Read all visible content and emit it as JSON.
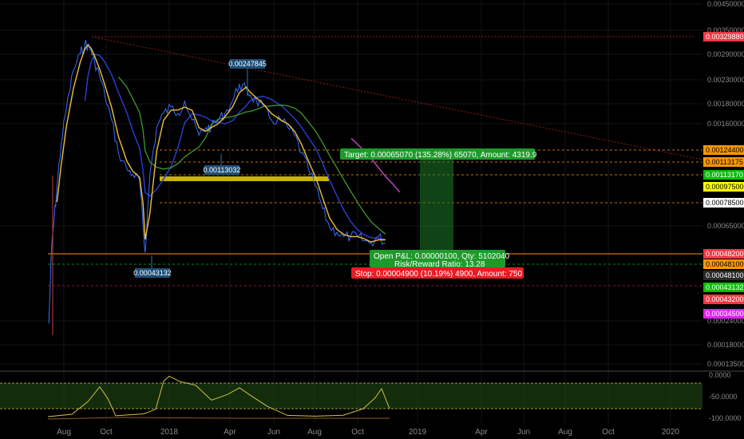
{
  "chart_data": {
    "type": "line",
    "log_scale": true,
    "grid": true,
    "price_axis_labels": [
      "0.00450000",
      "0.00350000",
      "0.00290000",
      "0.00230000",
      "0.00180000",
      "0.00160000",
      "0.00065000",
      "0.00024000",
      "0.00018000",
      "0.00013500"
    ],
    "time_axis_labels": [
      "Aug",
      "Oct",
      "2018",
      "Apr",
      "Jun",
      "Aug",
      "Oct",
      "2019",
      "Apr",
      "Jun",
      "Aug",
      "Oct",
      "2020"
    ],
    "price_series": {
      "x": [
        "2017-07-10",
        "2017-07-14",
        "2017-07-18",
        "2017-07-22",
        "2017-07-28",
        "2017-08-05",
        "2017-08-15",
        "2017-08-25",
        "2017-09-01",
        "2017-09-05",
        "2017-09-10",
        "2017-09-15",
        "2017-09-22",
        "2017-09-30",
        "2017-10-10",
        "2017-10-20",
        "2017-11-01",
        "2017-11-10",
        "2017-11-20",
        "2017-11-25",
        "2017-11-28",
        "2017-12-05",
        "2017-12-15",
        "2017-12-25",
        "2018-01-05",
        "2018-01-15",
        "2018-01-25",
        "2018-02-05",
        "2018-02-15",
        "2018-02-25",
        "2018-03-05",
        "2018-03-15",
        "2018-03-25",
        "2018-04-05",
        "2018-04-15",
        "2018-04-25",
        "2018-05-01",
        "2018-05-10",
        "2018-05-20",
        "2018-06-01",
        "2018-06-15",
        "2018-06-25",
        "2018-07-05",
        "2018-07-15",
        "2018-07-25",
        "2018-08-05",
        "2018-08-15",
        "2018-08-25",
        "2018-09-05",
        "2018-09-15",
        "2018-09-25",
        "2018-10-05",
        "2018-10-15",
        "2018-10-25",
        "2018-11-05",
        "2018-11-15"
      ],
      "y": [
        0.00022,
        0.00045,
        0.0006,
        0.0008,
        0.0012,
        0.0017,
        0.0024,
        0.0028,
        0.0031,
        0.003,
        0.0029,
        0.0026,
        0.0023,
        0.0019,
        0.0015,
        0.0011,
        0.00095,
        0.0009,
        0.00085,
        0.00055,
        0.00043,
        0.0009,
        0.0014,
        0.0016,
        0.0017,
        0.0016,
        0.0018,
        0.0015,
        0.0013,
        0.0014,
        0.0014,
        0.0015,
        0.0016,
        0.0018,
        0.0021,
        0.002,
        0.0019,
        0.0018,
        0.0017,
        0.0015,
        0.0015,
        0.0014,
        0.0013,
        0.0011,
        0.00095,
        0.0008,
        0.00065,
        0.00055,
        0.00052,
        0.0005,
        0.0005,
        0.0005,
        0.00048,
        0.00047,
        0.0005,
        0.00047
      ]
    },
    "annotations": [
      "0.00247845",
      "0.00113032",
      "0.00043132"
    ],
    "position": {
      "target_text": "Target: 0.00065070 (135.28%) 65070, Amount: 4319.9",
      "open_text": "Open P&L: 0.00000100, Qty: 5102040",
      "rr_text": "Risk/Reward Ratio: 13.28",
      "stop_text": "Stop: 0.00004900 (10.19%) 4900, Amount: 750"
    },
    "price_tags": [
      {
        "text": "0.00329880",
        "bg": "#f23645",
        "fg": "#ffffff"
      },
      {
        "text": "0.00124400",
        "bg": "#ff9800",
        "fg": "#000000"
      },
      {
        "text": "0.00113175",
        "bg": "#ff9800",
        "fg": "#000000"
      },
      {
        "text": "0.00113170",
        "bg": "#00c000",
        "fg": "#ffffff"
      },
      {
        "text": "0.00097500",
        "bg": "#ffff00",
        "fg": "#000000"
      },
      {
        "text": "0.00078500",
        "bg": "#ffffff",
        "fg": "#000000"
      },
      {
        "text": "0.00048200",
        "bg": "#f23645",
        "fg": "#ffffff"
      },
      {
        "text": "0.00048100",
        "bg": "#ff9800",
        "fg": "#000000"
      },
      {
        "text": "0.00048100",
        "bg": "#2a2a2a",
        "fg": "#ffffff"
      },
      {
        "text": "0.00043132",
        "bg": "#00c000",
        "fg": "#ffffff"
      },
      {
        "text": "0.00043200",
        "bg": "#f23645",
        "fg": "#ffffff"
      },
      {
        "text": "0.00034500",
        "bg": "#e81cff",
        "fg": "#ffffff"
      }
    ],
    "rsi_axis_labels": [
      "0.0000",
      "-50.0000",
      "-100.0000"
    ],
    "colors": {
      "price": "#3b6cff",
      "ma_fast": "#f0c030",
      "ma_blue": "#2a3cc8",
      "ma_green": "#3f9a2a",
      "ma_magenta": "#c040c0",
      "target_green": "#1e9a2a",
      "stop_red": "#e81c24",
      "yellow_band": "#c8b400"
    }
  }
}
